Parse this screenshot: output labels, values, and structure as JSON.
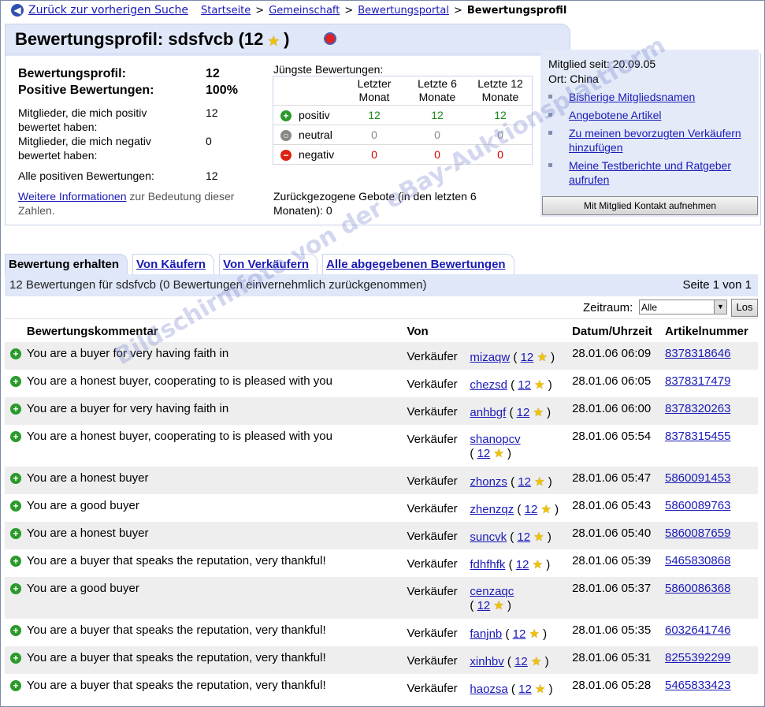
{
  "breadcrumb": {
    "back": "Zurück zur vorherigen Suche",
    "items": [
      "Startseite",
      "Gemeinschaft",
      "Bewertungsportal"
    ],
    "current": "Bewertungsprofil",
    "sep": ">"
  },
  "title": {
    "text": "Bewertungsprofil: sdsfvcb (12",
    "close": ")"
  },
  "summary": {
    "profile_label": "Bewertungsprofil:",
    "profile_value": "12",
    "positive_label": "Positive Bewertungen:",
    "positive_value": "100%",
    "pos_members_label": "Mitglieder, die mich positiv bewertet haben:",
    "pos_members_value": "12",
    "neg_members_label": "Mitglieder, die mich negativ bewertet haben:",
    "neg_members_value": "0",
    "all_pos_label": "Alle positiven Bewertungen:",
    "all_pos_value": "12",
    "more_link": "Weitere Informationen",
    "more_text": " zur Bedeutung dieser Zahlen."
  },
  "recent": {
    "heading": "Jüngste Bewertungen:",
    "col1": "Letzter Monat",
    "col2": "Letzte 6 Monate",
    "col3": "Letzte 12 Monate",
    "rows": [
      {
        "label": "positiv",
        "v1": "12",
        "v2": "12",
        "v3": "12"
      },
      {
        "label": "neutral",
        "v1": "0",
        "v2": "0",
        "v3": "0"
      },
      {
        "label": "negativ",
        "v1": "0",
        "v2": "0",
        "v3": "0"
      }
    ],
    "withdrawn": "Zurückgezogene Gebote (in den letzten 6 Monaten): 0"
  },
  "member": {
    "since": "Mitglied seit: 20.09.05",
    "location": "Ort: China",
    "links": [
      "Bisherige Mitgliedsnamen",
      "Angebotene Artikel",
      "Zu meinen bevorzugten Verkäufern hinzufügen",
      "Meine Testberichte und Ratgeber aufrufen"
    ],
    "contact_button": "Mit Mitglied Kontakt aufnehmen"
  },
  "tabs": [
    "Bewertung erhalten",
    "Von Käufern",
    "Von Verkäufern",
    "Alle abgegebenen Bewertungen"
  ],
  "list": {
    "summary": "12 Bewertungen für sdsfvcb (0 Bewertungen einvernehmlich zurückgenommen)",
    "page": "Seite 1 von 1",
    "period_label": "Zeitraum:",
    "period_value": "Alle",
    "go_button": "Los",
    "headers": [
      "Bewertungskommentar",
      "Von",
      "Datum/Uhrzeit",
      "Artikelnummer"
    ],
    "rows": [
      {
        "comment": "You are a buyer for very having faith in",
        "role": "Verkäufer",
        "user": "mizaqw",
        "score": "12",
        "date": "28.01.06 06:09",
        "item": "8378318646"
      },
      {
        "comment": "You are a honest buyer, cooperating to is pleased with you",
        "role": "Verkäufer",
        "user": "chezsd",
        "score": "12",
        "date": "28.01.06 06:05",
        "item": "8378317479"
      },
      {
        "comment": "You are a buyer for very having faith in",
        "role": "Verkäufer",
        "user": "anhbgf",
        "score": "12",
        "date": "28.01.06 06:00",
        "item": "8378320263"
      },
      {
        "comment": "You are a honest buyer, cooperating to is pleased with you",
        "role": "Verkäufer",
        "user": "shanopcv",
        "score": "12",
        "date": "28.01.06 05:54",
        "item": "8378315455"
      },
      {
        "comment": "You are a honest buyer",
        "role": "Verkäufer",
        "user": "zhonzs",
        "score": "12",
        "date": "28.01.06 05:47",
        "item": "5860091453"
      },
      {
        "comment": "You are a good buyer",
        "role": "Verkäufer",
        "user": "zhenzqz",
        "score": "12",
        "date": "28.01.06 05:43",
        "item": "5860089763"
      },
      {
        "comment": "You are a honest buyer",
        "role": "Verkäufer",
        "user": "suncvk",
        "score": "12",
        "date": "28.01.06 05:40",
        "item": "5860087659"
      },
      {
        "comment": "You are a buyer that speaks the reputation, very thankful!",
        "role": "Verkäufer",
        "user": "fdhfhfk",
        "score": "12",
        "date": "28.01.06 05:39",
        "item": "5465830868"
      },
      {
        "comment": "You are a good buyer",
        "role": "Verkäufer",
        "user": "cenzaqc",
        "score": "12",
        "date": "28.01.06 05:37",
        "item": "5860086368"
      },
      {
        "comment": "You are a buyer that speaks the reputation, very thankful!",
        "role": "Verkäufer",
        "user": "fanjnb",
        "score": "12",
        "date": "28.01.06 05:35",
        "item": "6032641746"
      },
      {
        "comment": "You are a buyer that speaks the reputation, very thankful!",
        "role": "Verkäufer",
        "user": "xinhbv",
        "score": "12",
        "date": "28.01.06 05:31",
        "item": "8255392299"
      },
      {
        "comment": "You are a buyer that speaks the reputation, very thankful!",
        "role": "Verkäufer",
        "user": "haozsa",
        "score": "12",
        "date": "28.01.06 05:28",
        "item": "5465833423"
      }
    ]
  },
  "watermark": "Bildschirmfoto von der eBay-Auktionsplattform",
  "colors": {
    "link": "#1a1ab8",
    "panel": "#dfe7f8",
    "positive": "#1a8a1a",
    "negative": "#d20000"
  }
}
